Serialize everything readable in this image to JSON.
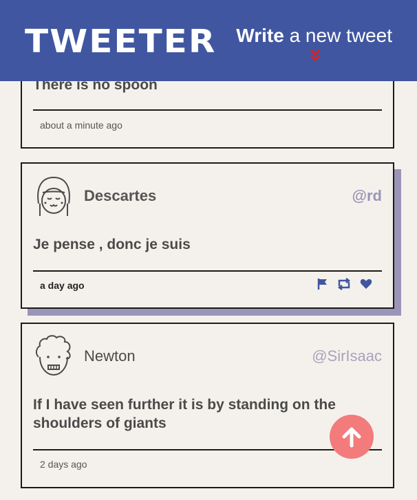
{
  "header": {
    "logo": "TWEETER",
    "compose_strong": "Write",
    "compose_rest": " a new tweet",
    "chevron_icon": "double-chevron-down-icon",
    "chevron_color": "#e02020",
    "background": "#4056a1"
  },
  "tweets": [
    {
      "content": "There is no spoon",
      "time": "about a minute ago"
    },
    {
      "name": "Descartes",
      "handle": "@rd",
      "avatar_icon": "girl-avatar-icon",
      "content": "Je pense , donc je suis",
      "time": "a day ago",
      "actions": [
        "flag-icon",
        "retweet-icon",
        "heart-icon"
      ]
    },
    {
      "name": "Newton",
      "handle": "@SirIsaac",
      "avatar_icon": "curly-hair-avatar-icon",
      "content": "If I have seen further it is by standing on the shoulders of giants",
      "time": "2 days ago"
    }
  ],
  "scroll_top": {
    "icon": "arrow-up-icon",
    "color": "#f37b7b"
  },
  "colors": {
    "accent": "#4056a1",
    "shadow": "#9a95b8",
    "page": "#f4f1ec"
  }
}
